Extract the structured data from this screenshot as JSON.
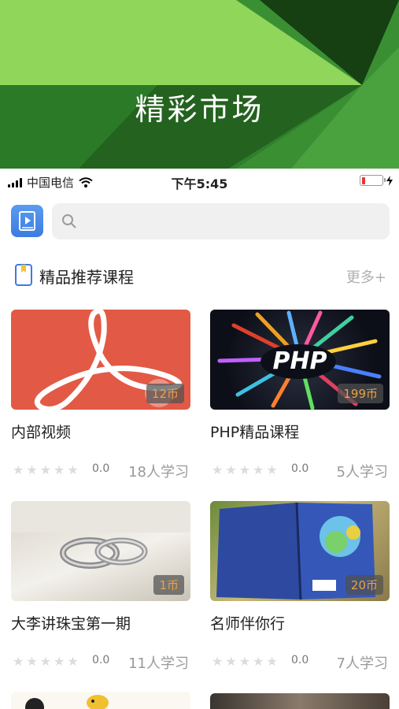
{
  "banner": {
    "title": "精彩市场"
  },
  "status_bar": {
    "carrier": "中国电信",
    "time": "下午5:45"
  },
  "search": {
    "placeholder": ""
  },
  "section": {
    "title": "精品推荐课程",
    "more": "更多+"
  },
  "courses": [
    {
      "title": "内部视频",
      "price": "12币",
      "rating": "0.0",
      "learners": "18人学习",
      "thumb": "pdf-logo"
    },
    {
      "title": "PHP精品课程",
      "price": "199币",
      "rating": "0.0",
      "learners": "5人学习",
      "thumb": "php-burst",
      "thumb_text": "PHP"
    },
    {
      "title": "大李讲珠宝第一期",
      "price": "1币",
      "rating": "0.0",
      "learners": "11人学习",
      "thumb": "rings-photo"
    },
    {
      "title": "名师伴你行",
      "price": "20币",
      "rating": "0.0",
      "learners": "7人学习",
      "thumb": "blue-book"
    }
  ],
  "colors": {
    "banner_light": "#8fd65a",
    "banner_dark": "#1f4f1a",
    "accent_blue": "#3d7be0",
    "price_text": "#e8a24a"
  }
}
